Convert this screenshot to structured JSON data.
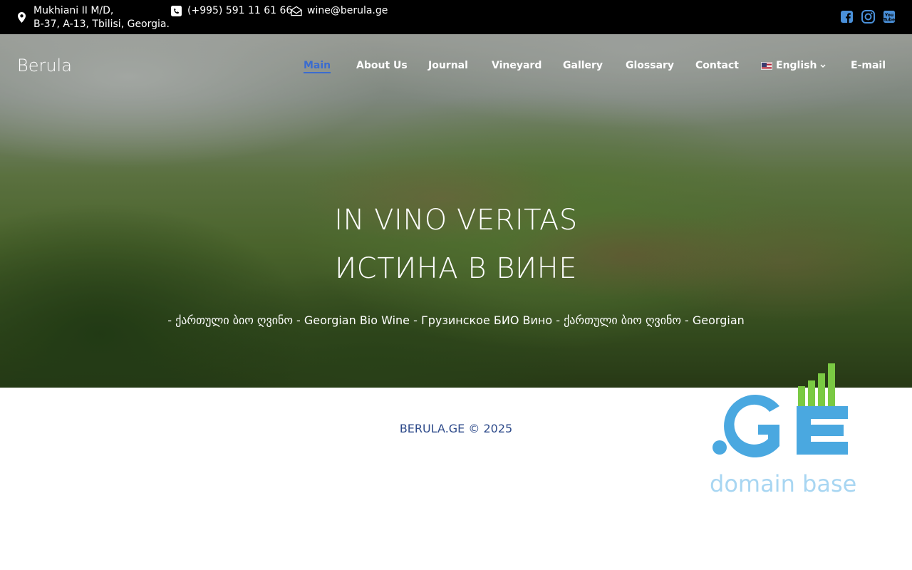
{
  "topbar": {
    "address_line1": "Mukhiani II M/D,",
    "address_line2": "B-37, A-13, Tbilisi, Georgia.",
    "phone": "(+995) 591 11 61 66",
    "email": "wine@berula.ge",
    "socials": [
      "facebook-icon",
      "instagram-icon",
      "youtube-icon"
    ]
  },
  "header": {
    "brand": "Berula",
    "nav": {
      "main": "Main",
      "about": "About Us",
      "journal": "Journal",
      "vineyard": "Vineyard",
      "gallery": "Gallery",
      "glossary": "Glossary",
      "contact": "Contact",
      "language": "English",
      "email": "E-mail"
    },
    "active_item": "Main"
  },
  "hero": {
    "headline1": "IN VINO VERITAS",
    "headline2": "ИСТИНА В ВИНЕ",
    "ticker": "- ქართული ბიო ღვინო - Georgian Bio Wine - Грузинское БИО Вино - ქართული ბიო ღვინო - Georgian"
  },
  "footer": {
    "copyright": "BERULA.GE © 2025",
    "badge_text": ".GE",
    "badge_subtext": "domain base"
  },
  "colors": {
    "topbar_bg": "#000000",
    "active_nav": "#3b6ccf",
    "copyright": "#2d4a8a",
    "ge_blue": "#4aa8e0",
    "ge_green": "#7ac943",
    "domain_base": "#a8d6f2"
  }
}
